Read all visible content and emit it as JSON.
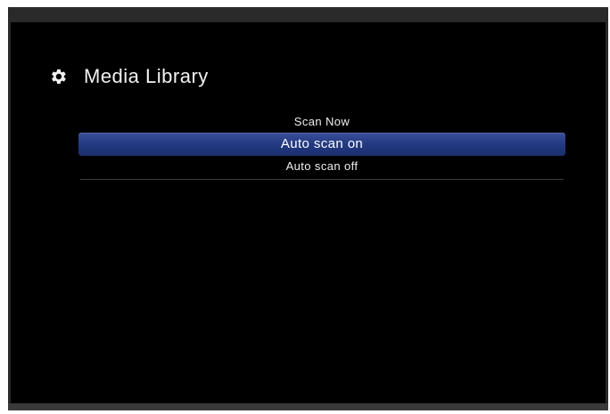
{
  "header": {
    "title": "Media Library",
    "icon": "gear-icon"
  },
  "menu": {
    "items": [
      {
        "label": "Scan Now",
        "selected": false
      },
      {
        "label": "Auto scan on",
        "selected": true
      },
      {
        "label": "Auto scan off",
        "selected": false
      }
    ]
  },
  "colors": {
    "background": "#000000",
    "highlight": "#233a82",
    "text": "#eeeeee"
  }
}
